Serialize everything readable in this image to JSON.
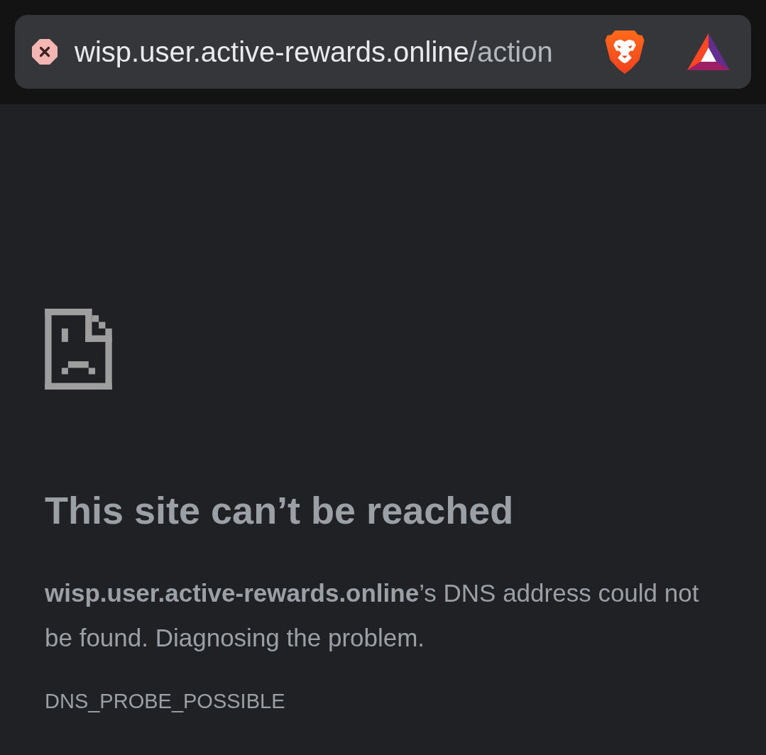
{
  "address_bar": {
    "host": "wisp.user.active-rewards.online",
    "path": "/action"
  },
  "error_page": {
    "title": "This site can’t be reached",
    "message": "**wisp.user.active-rewards.online**’s DNS address could not be found. Diagnosing the problem.",
    "error_code": "DNS_PROBE_POSSIBLE"
  }
}
